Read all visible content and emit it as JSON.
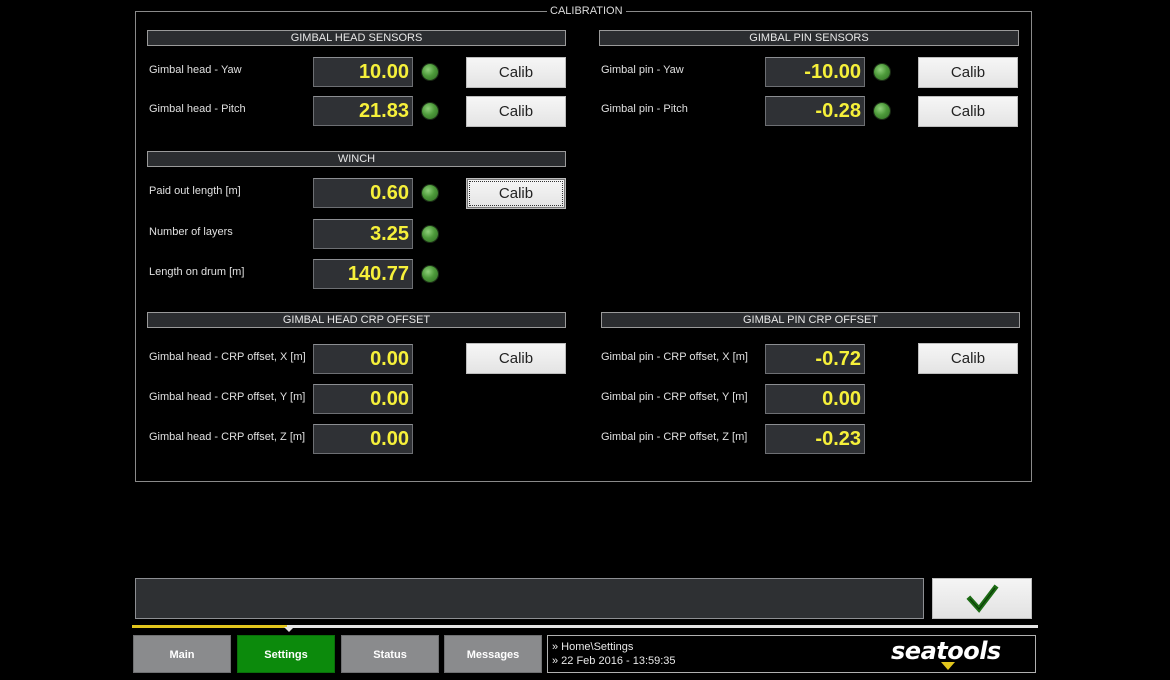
{
  "calibration": {
    "title": "CALIBRATION",
    "gimbal_head_sensors": {
      "title": "GIMBAL HEAD SENSORS",
      "rows": [
        {
          "label": "Gimbal head - Yaw",
          "value": "10.00",
          "button": "Calib"
        },
        {
          "label": "Gimbal head - Pitch",
          "value": "21.83",
          "button": "Calib"
        }
      ]
    },
    "gimbal_pin_sensors": {
      "title": "GIMBAL PIN SENSORS",
      "rows": [
        {
          "label": "Gimbal pin - Yaw",
          "value": "-10.00",
          "button": "Calib"
        },
        {
          "label": "Gimbal pin - Pitch",
          "value": "-0.28",
          "button": "Calib"
        }
      ]
    },
    "winch": {
      "title": "WINCH",
      "rows": [
        {
          "label": "Paid out length [m]",
          "value": "0.60",
          "button": "Calib"
        },
        {
          "label": "Number of layers",
          "value": "3.25"
        },
        {
          "label": "Length on drum [m]",
          "value": "140.77"
        }
      ]
    },
    "gimbal_head_crp_offset": {
      "title": "GIMBAL HEAD CRP OFFSET",
      "button": "Calib",
      "rows": [
        {
          "label": "Gimbal head - CRP offset, X [m]",
          "value": "0.00"
        },
        {
          "label": "Gimbal head - CRP offset, Y [m]",
          "value": "0.00"
        },
        {
          "label": "Gimbal head - CRP offset, Z [m]",
          "value": "0.00"
        }
      ]
    },
    "gimbal_pin_crp_offset": {
      "title": "GIMBAL PIN CRP OFFSET",
      "button": "Calib",
      "rows": [
        {
          "label": "Gimbal pin - CRP offset, X [m]",
          "value": "-0.72"
        },
        {
          "label": "Gimbal pin - CRP offset, Y [m]",
          "value": "0.00"
        },
        {
          "label": "Gimbal pin - CRP offset, Z [m]",
          "value": "-0.23"
        }
      ]
    }
  },
  "message_bar": {
    "text": ""
  },
  "ok_button": {
    "icon": "checkmark-icon",
    "color": "#1c6b14"
  },
  "nav": {
    "tabs": [
      {
        "label": "Main"
      },
      {
        "label": "Settings",
        "active": true
      },
      {
        "label": "Status"
      },
      {
        "label": "Messages"
      }
    ]
  },
  "status": {
    "path": "» Home\\Settings",
    "datetime": "» 22 Feb 2016 - 13:59:35"
  },
  "brand": {
    "name": "seatools"
  },
  "colors": {
    "value_text": "#f6f03a",
    "led_on": "#4d9a3a",
    "active_tab": "#0c8a0c",
    "accent": "#e2c61d"
  }
}
